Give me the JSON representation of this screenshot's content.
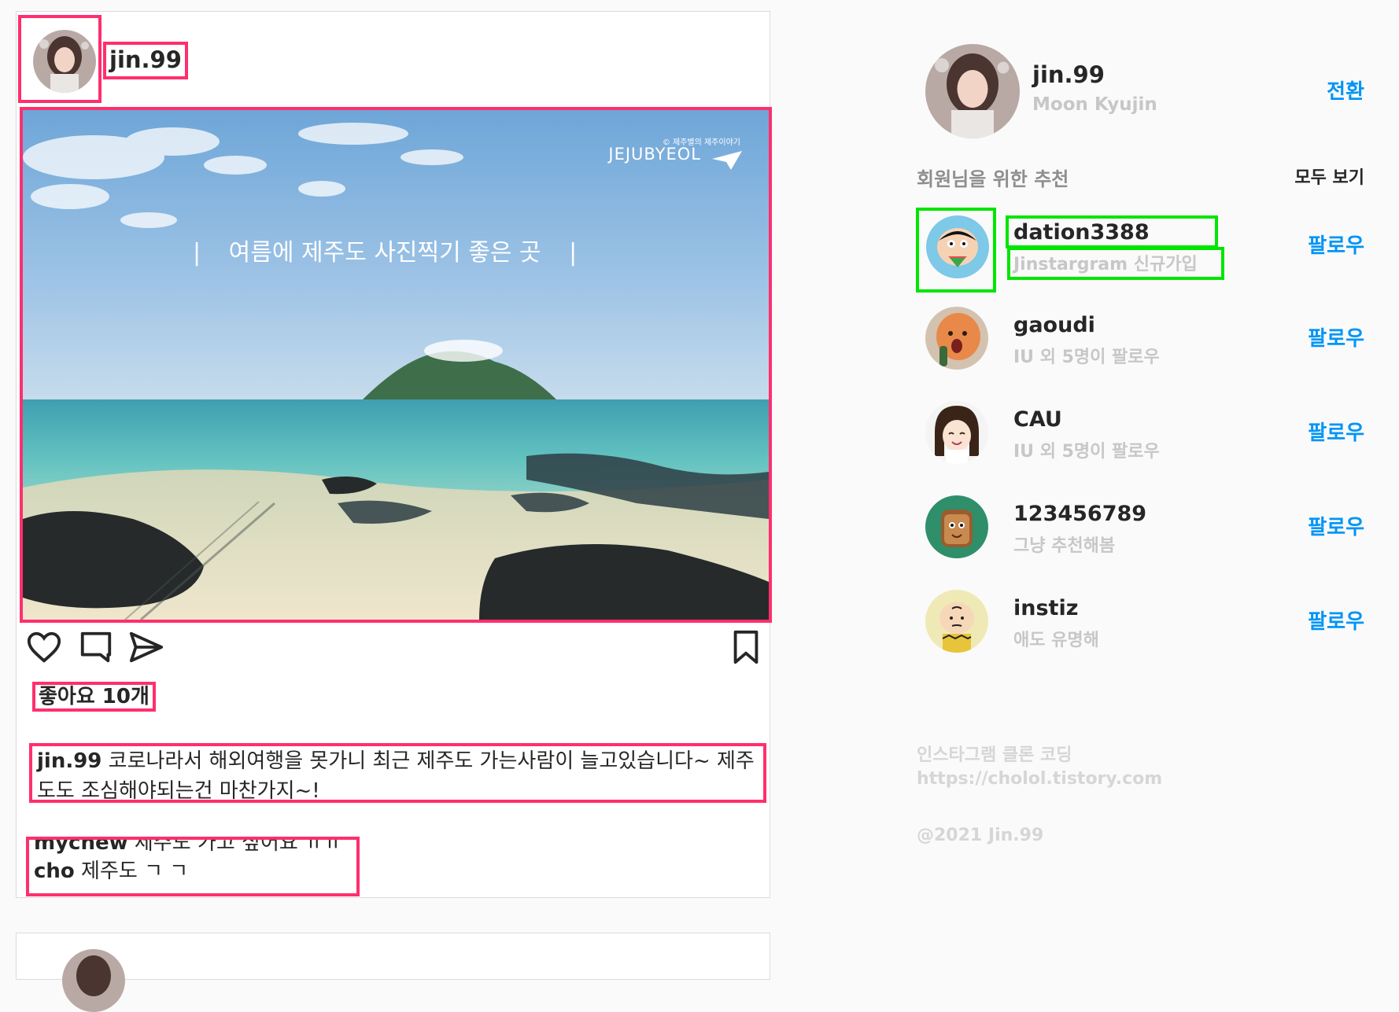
{
  "post": {
    "username": "jin.99",
    "photo": {
      "watermark_small": "© 제주별의 제주이야기",
      "watermark_brand": "JEJUBYEOL",
      "overlay_text": "여름에 제주도 사진찍기 좋은 곳"
    },
    "likes": "좋아요 10개",
    "caption": {
      "author": "jin.99",
      "text": " 코로나라서 해외여행을 못가니 최근 제주도 가는사람이 늘고있습니다~ 제주도도 조심해야되는건 마찬가지~!"
    },
    "comments": [
      {
        "author": "mychew",
        "text": " 제주도 가고 싶어요 ㅠㅠ"
      },
      {
        "author": "cho",
        "text": " 제주도 ㄱ ㄱ"
      }
    ]
  },
  "sidebar": {
    "me": {
      "username": "jin.99",
      "fullname": "Moon Kyujin",
      "switch_label": "전환"
    },
    "suggest_title": "회원님을 위한 추천",
    "see_all_label": "모두 보기",
    "suggestions": [
      {
        "username": "dation3388",
        "subtitle": "Jinstargram 신규가입",
        "follow_label": "팔로우"
      },
      {
        "username": "gaoudi",
        "subtitle": "IU 외 5명이 팔로우",
        "follow_label": "팔로우"
      },
      {
        "username": "CAU",
        "subtitle": "IU 외 5명이 팔로우",
        "follow_label": "팔로우"
      },
      {
        "username": "123456789",
        "subtitle": "그냥 추천해봄",
        "follow_label": "팔로우"
      },
      {
        "username": "instiz",
        "subtitle": "애도 유명해",
        "follow_label": "팔로우"
      }
    ],
    "footer": {
      "line1": "인스타그램 클론 코딩",
      "line2": "https://cholol.tistory.com",
      "line3": "@2021 Jin.99"
    }
  },
  "colors": {
    "highlight_pink": "#ff2f6e",
    "highlight_green": "#00e600",
    "link_blue": "#0095f6",
    "muted_gray": "#c7c7c7"
  },
  "icons": [
    "heart-icon",
    "comment-icon",
    "share-icon",
    "bookmark-icon"
  ]
}
